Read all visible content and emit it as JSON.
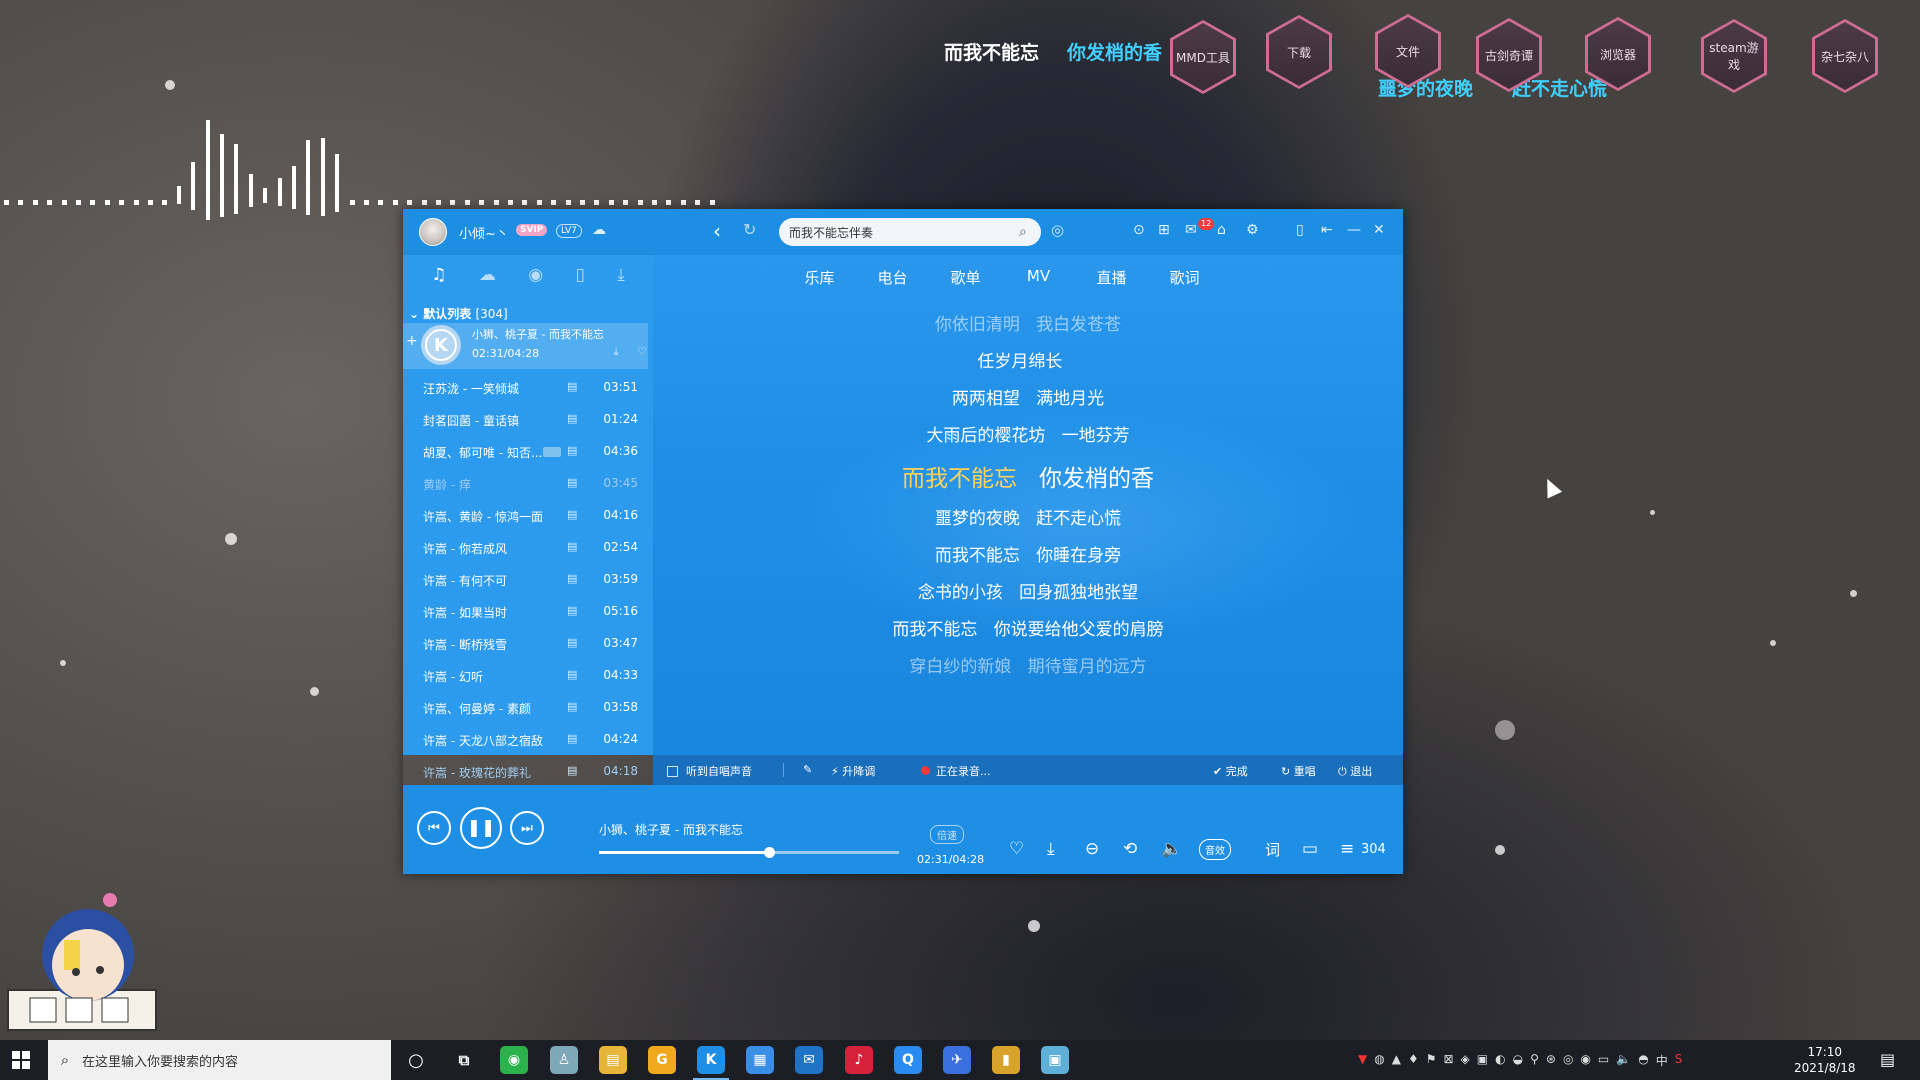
{
  "desktop": {
    "lyric_line1_a": "而我不能忘",
    "lyric_line1_b": "你发梢的香",
    "lyric_line2_a": "噩梦的夜晚",
    "lyric_line2_b": "赶不走心慌",
    "icons": [
      "MMD工具",
      "下载",
      "文件",
      "古剑奇谭",
      "浏览器",
      "steam游戏",
      "杂七杂八"
    ]
  },
  "player": {
    "user": {
      "name": "小倾~丶",
      "svip": "SVIP",
      "level": "LV7"
    },
    "search": {
      "value": "而我不能忘伴奏"
    },
    "message_badge": "12",
    "sidebar": {
      "list_title": "默认列表",
      "list_count": "[304]",
      "current": {
        "title": "小狮、桃子夏 - 而我不能忘",
        "time": "02:31/04:28"
      },
      "songs": [
        {
          "name": "汪苏泷 - 一笑倾城",
          "duration": "03:51"
        },
        {
          "name": "封茗囧菌 - 童话镇",
          "duration": "01:24"
        },
        {
          "name": "胡夏、郁可唯 - 知否...",
          "duration": "04:36"
        },
        {
          "name": "黄龄 - 痒",
          "duration": "03:45"
        },
        {
          "name": "许嵩、黄龄 - 惊鸿一面",
          "duration": "04:16"
        },
        {
          "name": "许嵩 - 你若成风",
          "duration": "02:54"
        },
        {
          "name": "许嵩 - 有何不可",
          "duration": "03:59"
        },
        {
          "name": "许嵩 - 如果当时",
          "duration": "05:16"
        },
        {
          "name": "许嵩 - 断桥残雪",
          "duration": "03:47"
        },
        {
          "name": "许嵩 - 幻听",
          "duration": "04:33"
        },
        {
          "name": "许嵩、何曼婷 - 素颜",
          "duration": "03:58"
        },
        {
          "name": "许嵩 - 天龙八部之宿敌",
          "duration": "04:24"
        },
        {
          "name": "许嵩 - 玫瑰花的葬礼",
          "duration": "04:18"
        }
      ]
    },
    "tabs": [
      "乐库",
      "电台",
      "歌单",
      "MV",
      "直播",
      "歌词"
    ],
    "lyrics": [
      {
        "a": "你依旧清明",
        "b": "我白发苍苍"
      },
      {
        "a": "任岁月绵长",
        "b": ""
      },
      {
        "a": "两两相望",
        "b": "满地月光"
      },
      {
        "a": "大雨后的樱花坊",
        "b": "一地芬芳"
      },
      {
        "a": "而我不能忘",
        "b": "你发梢的香"
      },
      {
        "a": "噩梦的夜晚",
        "b": "赶不走心慌"
      },
      {
        "a": "而我不能忘",
        "b": "你睡在身旁"
      },
      {
        "a": "念书的小孩",
        "b": "回身孤独地张望"
      },
      {
        "a": "而我不能忘",
        "b": "你说要给他父爱的肩膀"
      },
      {
        "a": "穿白纱的新娘",
        "b": "期待蜜月的远方"
      }
    ],
    "karaoke": {
      "monitor": "听到自唱声音",
      "pitch": "升降调",
      "recording": "正在录音...",
      "done": "完成",
      "resing": "重唱",
      "exit": "退出"
    },
    "playbar": {
      "title": "小狮、桃子夏 - 而我不能忘",
      "time": "02:31/04:28",
      "progress": 0.565,
      "speed": "倍速",
      "effect": "音效",
      "lyric_btn": "词",
      "playlist_count": "304"
    }
  },
  "taskbar": {
    "search_placeholder": "在这里输入你要搜索的内容",
    "time": "17:10",
    "date": "2021/8/18",
    "ime": "中"
  }
}
